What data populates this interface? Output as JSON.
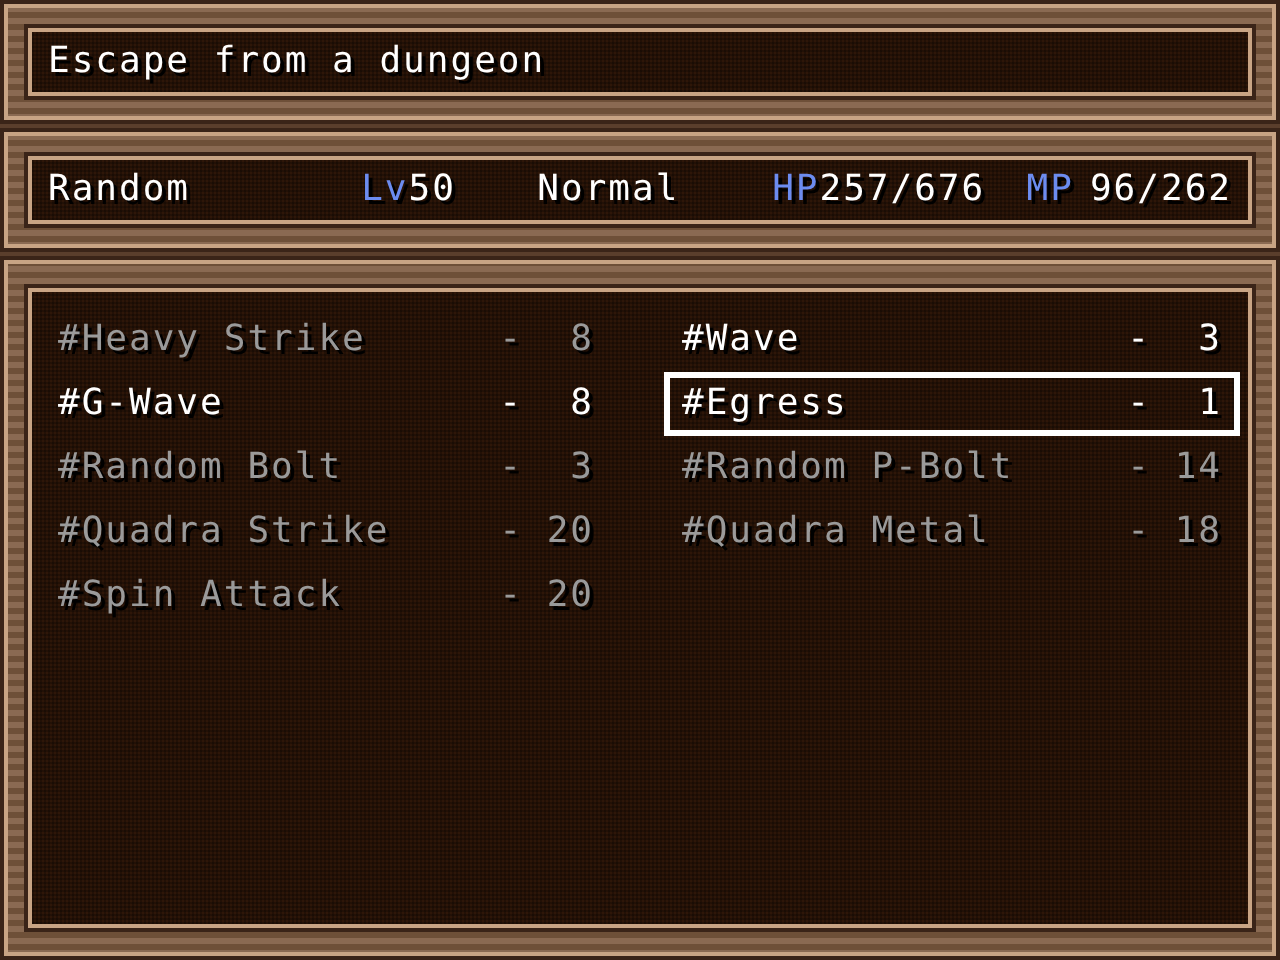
{
  "help_window": {
    "text": "Escape from a dungeon"
  },
  "status_window": {
    "name": "Random",
    "level_label": "Lv",
    "level": "50",
    "state": "Normal",
    "hp_label": "HP",
    "hp": "257/676",
    "mp_label": "MP",
    "mp": "96/262"
  },
  "skills": [
    {
      "name": "#Heavy Strike",
      "cost": "-  8",
      "enabled": false,
      "selected": false
    },
    {
      "name": "#Wave",
      "cost": "-  3",
      "enabled": true,
      "selected": false
    },
    {
      "name": "#G-Wave",
      "cost": "-  8",
      "enabled": true,
      "selected": false
    },
    {
      "name": "#Egress",
      "cost": "-  1",
      "enabled": true,
      "selected": true
    },
    {
      "name": "#Random Bolt",
      "cost": "-  3",
      "enabled": false,
      "selected": false
    },
    {
      "name": "#Random P-Bolt",
      "cost": "- 14",
      "enabled": false,
      "selected": false
    },
    {
      "name": "#Quadra Strike",
      "cost": "- 20",
      "enabled": false,
      "selected": false
    },
    {
      "name": "#Quadra Metal",
      "cost": "- 18",
      "enabled": false,
      "selected": false
    },
    {
      "name": "#Spin Attack",
      "cost": "- 20",
      "enabled": false,
      "selected": false
    }
  ]
}
